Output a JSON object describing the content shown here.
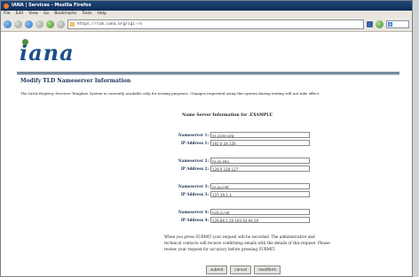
{
  "window": {
    "title": "IANA | Services - Mozilla Firefox"
  },
  "menu": [
    "File",
    "Edit",
    "View",
    "Go",
    "Bookmarks",
    "Tools",
    "Help"
  ],
  "address": {
    "url": "https://rzm.iana.org/cgi-rs"
  },
  "search": {
    "placeholder": "G"
  },
  "page": {
    "logo": "iana",
    "heading": "Modify TLD Nameserver Information",
    "notice": "The IANA Registry Services Template System is currently available only for testing purposes. Changes requested using this system during testing will not take effect.",
    "section_title": "Name Server Information for .EXAMPLE",
    "nameservers": [
      {
        "ns_label": "Nameserver 1:",
        "ns_value": "ns.icann.org",
        "ip_label": "IP Address 1:",
        "ip_value": "192.0.34.126"
      },
      {
        "ns_label": "Nameserver 2:",
        "ns_value": "ns.isi.edu",
        "ip_label": "IP Address 2:",
        "ip_value": "128.9.128.127"
      },
      {
        "ns_label": "Nameserver 3:",
        "ns_value": "ns.uu.net",
        "ip_label": "IP Address 3:",
        "ip_value": "137.39.1.3"
      },
      {
        "ns_label": "Nameserver 4:",
        "ns_value": "ns0.ja.net",
        "ip_label": "IP Address 4:",
        "ip_value": "128.86.1.20 193.63.94.20"
      }
    ],
    "submit_note": "When you press SUBMIT your request will be recorded. The administrative and technical contacts will receive confirming emails with the details of this request. Please review your request for accuracy before pressing SUBMIT.",
    "buttons": {
      "submit": "submit",
      "cancel": "cancel",
      "reset": "resetform"
    }
  }
}
